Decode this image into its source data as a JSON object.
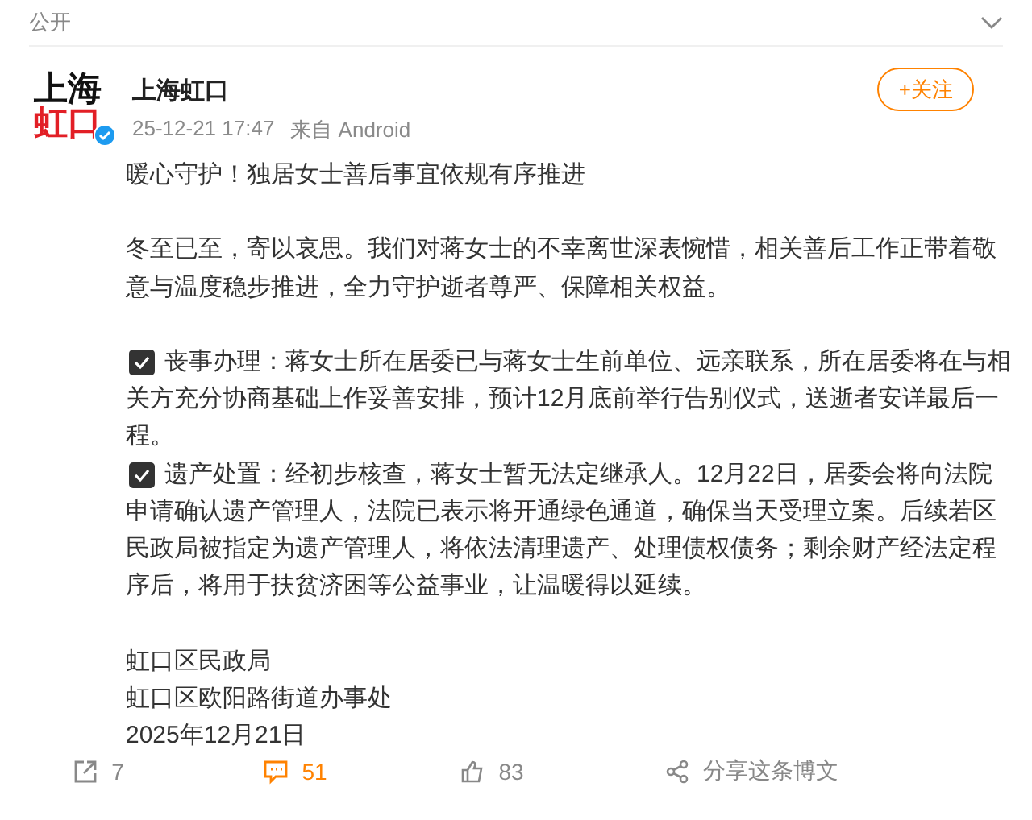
{
  "visibility": {
    "label": "公开"
  },
  "author": {
    "avatar_top": "上海",
    "avatar_bottom": "虹口",
    "verified": true,
    "name": "上海虹口",
    "time": "25-12-21 17:47",
    "source": "来自 Android",
    "follow_label": "+关注"
  },
  "post": {
    "title": "暖心守护！独居女士善后事宜依规有序推进",
    "intro": "冬至已至，寄以哀思。我们对蒋女士的不幸离世深表惋惜，相关善后工作正带着敬意与温度稳步推进，全力守护逝者尊严、保障相关权益。",
    "items": [
      {
        "checked": true,
        "text": "丧事办理：蒋女士所在居委已与蒋女士生前单位、远亲联系，所在居委将在与相关方充分协商基础上作妥善安排，预计12月底前举行告别仪式，送逝者安详最后一程。"
      },
      {
        "checked": true,
        "text": "遗产处置：经初步核查，蒋女士暂无法定继承人。12月22日，居委会将向法院申请确认遗产管理人，法院已表示将开通绿色通道，确保当天受理立案。后续若区民政局被指定为遗产管理人，将依法清理遗产、处理债权债务；剩余财产经法定程序后，将用于扶贫济困等公益事业，让温暖得以延续。"
      }
    ],
    "signature": [
      "虹口区民政局",
      "虹口区欧阳路街道办事处",
      "2025年12月21日"
    ]
  },
  "actions": [
    {
      "kind": "repost",
      "label": "7",
      "active": false
    },
    {
      "kind": "comment",
      "label": "51",
      "active": true
    },
    {
      "kind": "like",
      "label": "83",
      "active": false
    },
    {
      "kind": "share",
      "label": "分享这条博文",
      "active": false
    }
  ]
}
